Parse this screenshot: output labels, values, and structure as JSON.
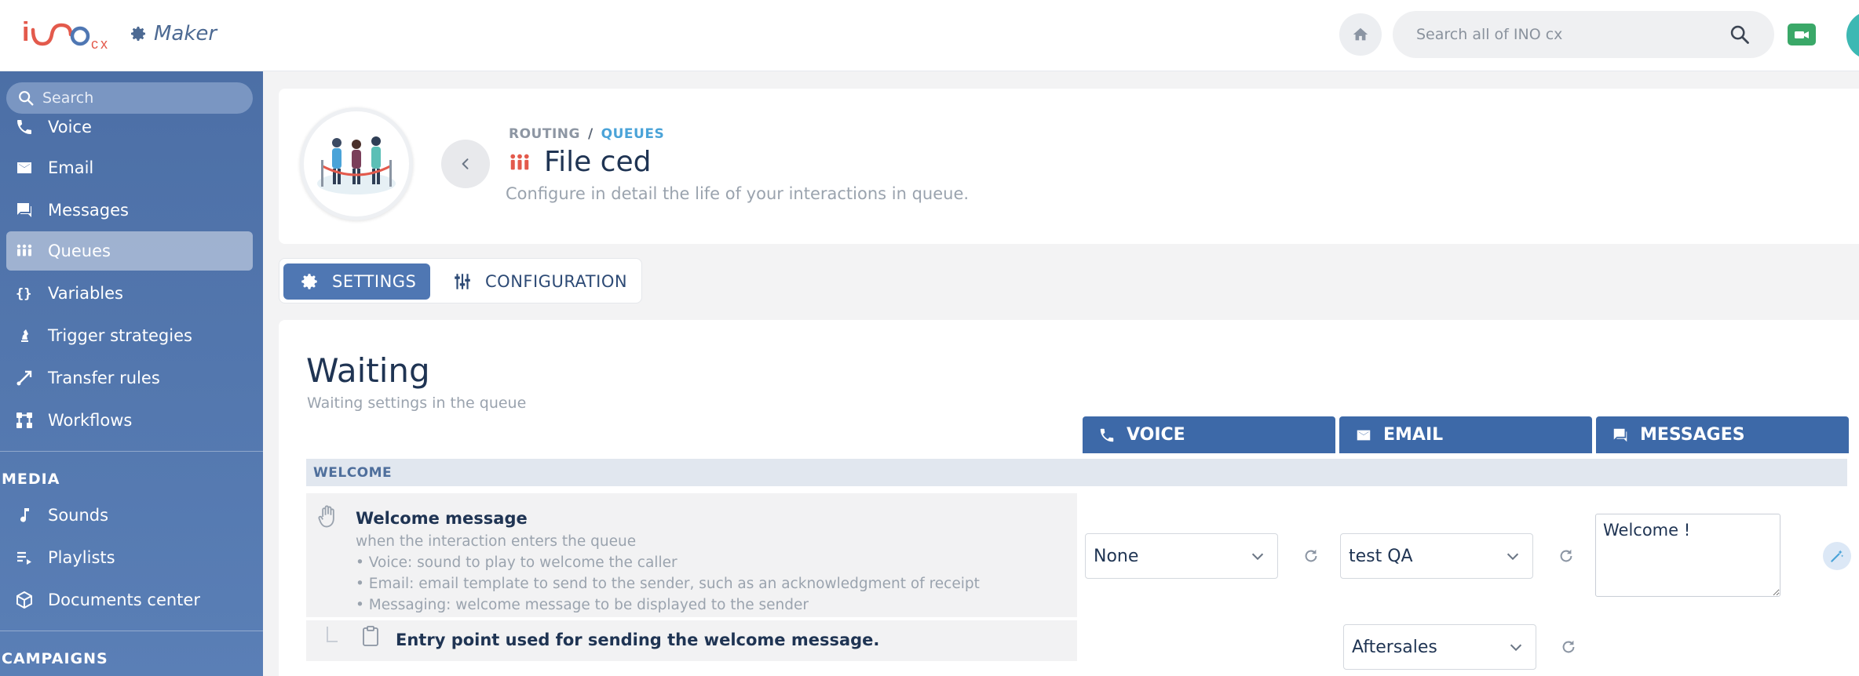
{
  "app": {
    "logo_text": "inocx",
    "product_label": "Maker",
    "search_placeholder": "Search all of INO cx"
  },
  "sidebar": {
    "search_placeholder": "Search",
    "items": [
      {
        "label": "Voice",
        "icon": "phone-icon"
      },
      {
        "label": "Email",
        "icon": "envelope-icon"
      },
      {
        "label": "Messages",
        "icon": "chat-icon"
      },
      {
        "label": "Queues",
        "icon": "people-icon",
        "active": true
      },
      {
        "label": "Variables",
        "icon": "braces-icon"
      },
      {
        "label": "Trigger strategies",
        "icon": "chess-icon"
      },
      {
        "label": "Transfer rules",
        "icon": "transfer-icon"
      },
      {
        "label": "Workflows",
        "icon": "workflow-icon"
      }
    ],
    "media_section": "MEDIA",
    "media_items": [
      {
        "label": "Sounds",
        "icon": "music-note-icon"
      },
      {
        "label": "Playlists",
        "icon": "playlist-icon"
      },
      {
        "label": "Documents center",
        "icon": "cube-icon"
      }
    ],
    "campaigns_section": "CAMPAIGNS"
  },
  "header": {
    "breadcrumb_root": "ROUTING",
    "breadcrumb_sep": "/",
    "breadcrumb_current": "QUEUES",
    "title": "File ced",
    "subtitle": "Configure in detail the life of your interactions in queue."
  },
  "tabs": {
    "settings": "SETTINGS",
    "configuration": "CONFIGURATION"
  },
  "section": {
    "title": "Waiting",
    "subtitle": "Waiting settings in the queue",
    "channels": {
      "voice": "VOICE",
      "email": "EMAIL",
      "messages": "MESSAGES"
    },
    "group_label": "WELCOME",
    "welcome": {
      "title": "Welcome message",
      "lines": [
        "when the interaction enters the queue",
        "• Voice: sound to play to welcome the caller",
        "• Email: email template to send to the sender, such as an acknowledgment of receipt",
        "• Messaging: welcome message to be displayed to the sender"
      ],
      "voice_value": "None",
      "email_value": "test QA",
      "messages_value": "Welcome !"
    },
    "entry_point": {
      "title": "Entry point used for sending the welcome message.",
      "email_value": "Aftersales"
    }
  },
  "colors": {
    "sidebar": "#4c6fa6",
    "channel_header": "#3d69a8",
    "active_tab": "#4f77b3",
    "breadcrumb_accent": "#4aa3d8",
    "brand_red": "#e35a4c"
  }
}
